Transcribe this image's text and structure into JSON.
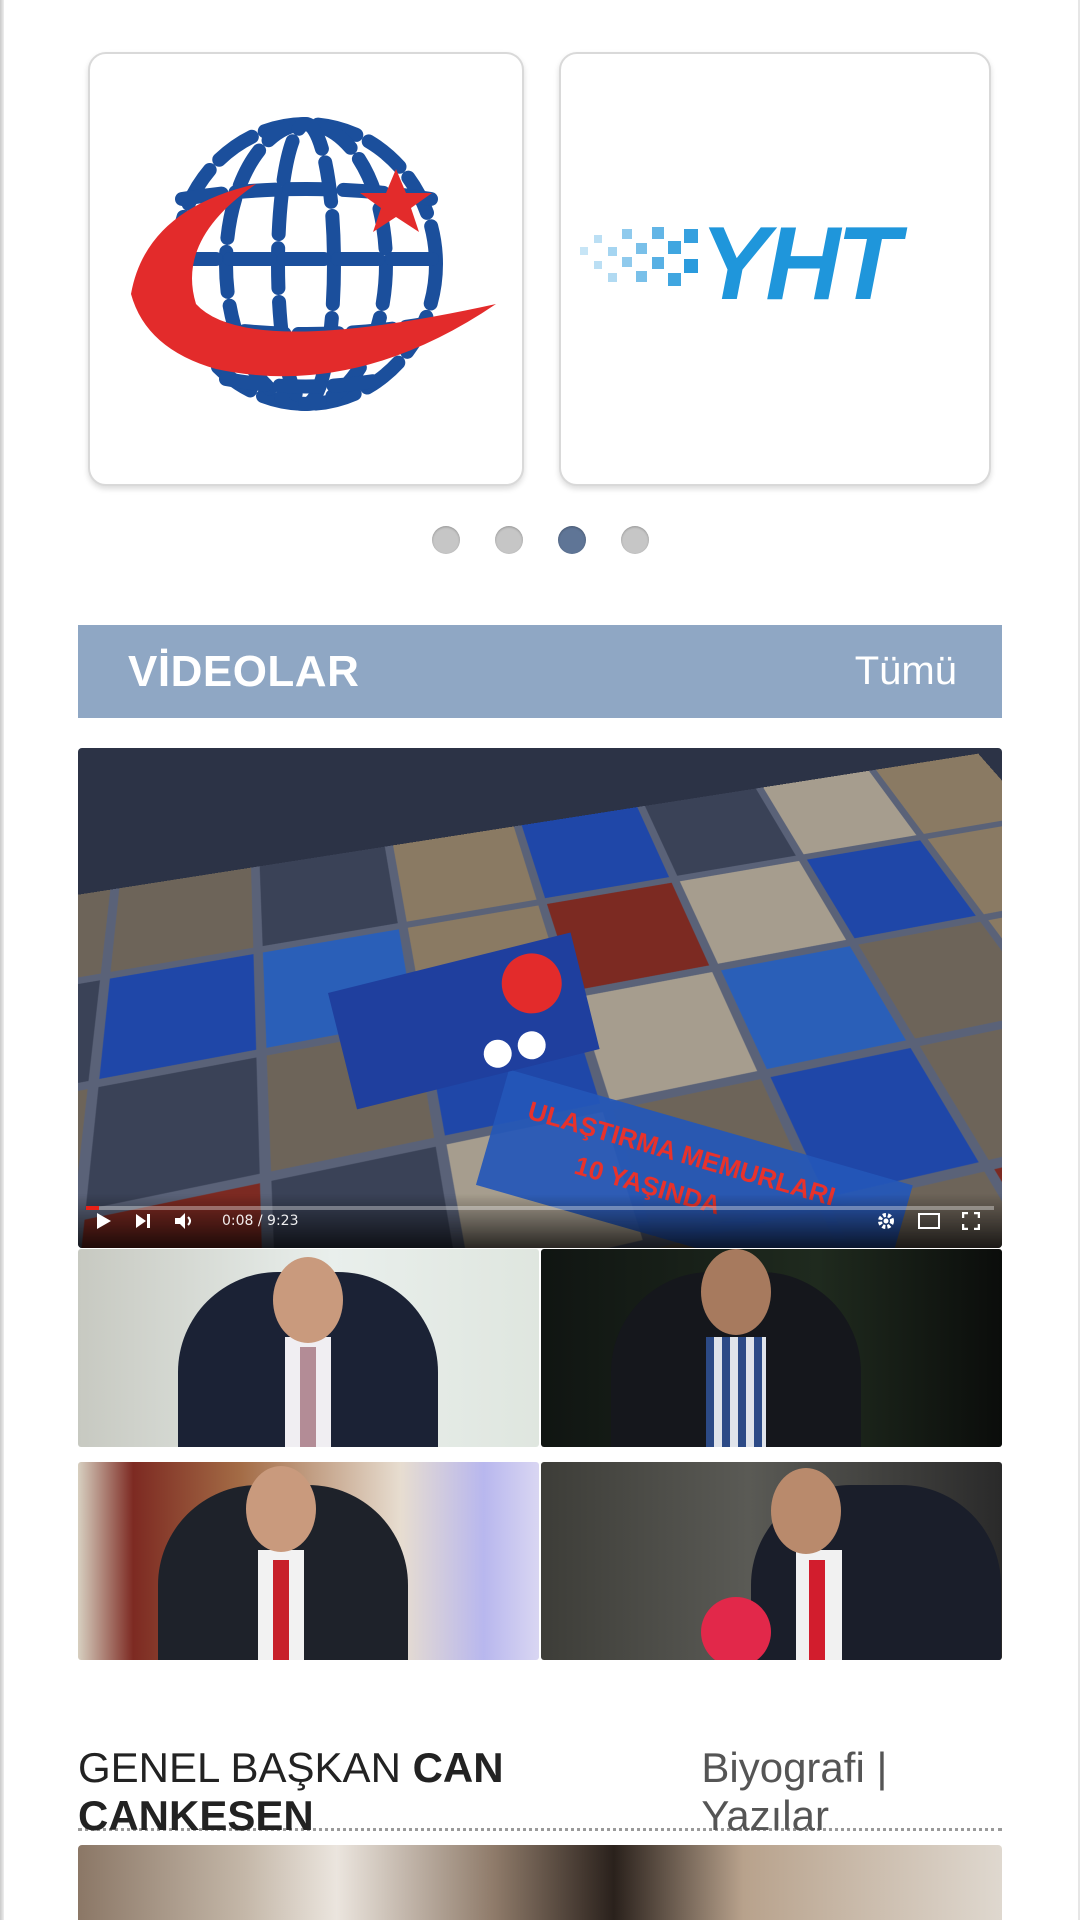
{
  "partners": {
    "logos": [
      {
        "icon": "ministry-globe-logo-icon",
        "colors": {
          "blue": "#1b4f9c",
          "red": "#e32b2b"
        }
      },
      {
        "icon": "yht-logo-icon",
        "text": "YHT",
        "colors": {
          "blue": "#1f96db"
        }
      }
    ],
    "pagination": {
      "count": 4,
      "active_index": 2
    }
  },
  "videos": {
    "title": "VİDEOLAR",
    "all_link": "Tümü",
    "main_video": {
      "time": "0:08 / 9:23",
      "progress": 0.014,
      "overlay_text": [
        "ULAŞTIRMA MEMURLARI",
        "10 YAŞINDA"
      ]
    },
    "thumbnails": [
      {
        "name": "video-thumbnail-1"
      },
      {
        "name": "video-thumbnail-2"
      },
      {
        "name": "video-thumbnail-3"
      },
      {
        "name": "video-thumbnail-4"
      }
    ]
  },
  "president": {
    "prefix": "GENEL BAŞKAN",
    "name": "CAN CANKESEN",
    "links": [
      "Biyografi",
      "Yazılar"
    ],
    "separator": "|"
  },
  "colors": {
    "section_bar": "#8fa7c4",
    "active_dot": "#5f7596",
    "inactive_dot": "#c6c6c6"
  }
}
